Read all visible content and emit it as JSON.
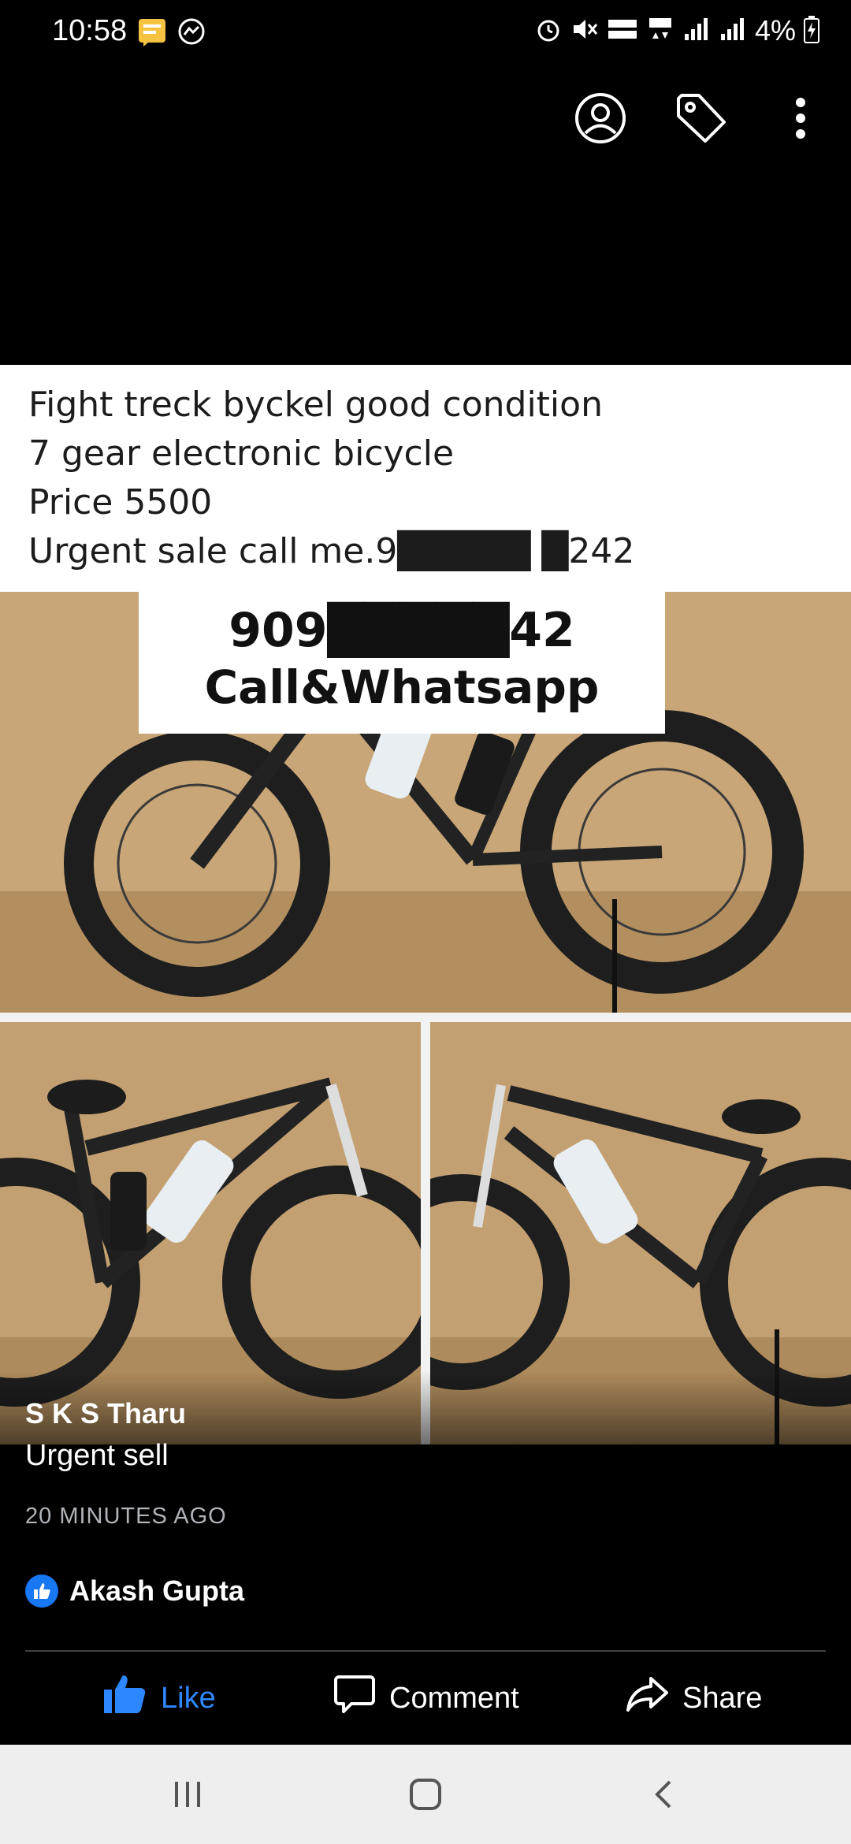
{
  "status_bar": {
    "time": "10:58",
    "battery_text": "4%",
    "icons": [
      "message-notification-icon",
      "messenger-icon",
      "alarm-icon",
      "mute-icon",
      "volte-icon",
      "4g-icon",
      "signal-icon",
      "signal-roaming-icon",
      "battery-charging-icon"
    ]
  },
  "top_actions": {
    "icons": [
      "profile-icon",
      "tag-icon",
      "more-options-icon"
    ]
  },
  "post": {
    "lines": [
      "Fight treck byckel good condition",
      "7 gear electronic bicycle",
      "Price 5500",
      "Urgent sale call me.9█████ █242"
    ],
    "overlay_number": "909█████42",
    "overlay_text": "Call&Whatsapp",
    "author": "S K S Tharu",
    "caption": "Urgent sell",
    "timestamp": "20 MINUTES AGO",
    "liked_by": "Akash Gupta"
  },
  "actions": {
    "like_label": "Like",
    "comment_label": "Comment",
    "share_label": "Share"
  },
  "nav": {
    "buttons": [
      "recent-apps-icon",
      "home-icon",
      "back-icon"
    ]
  },
  "colors": {
    "background": "#000000",
    "like_blue": "#2d88ff",
    "badge_blue": "#1877f2",
    "muted_text": "#b0b3b8",
    "nav_bg": "#eeeeee"
  }
}
